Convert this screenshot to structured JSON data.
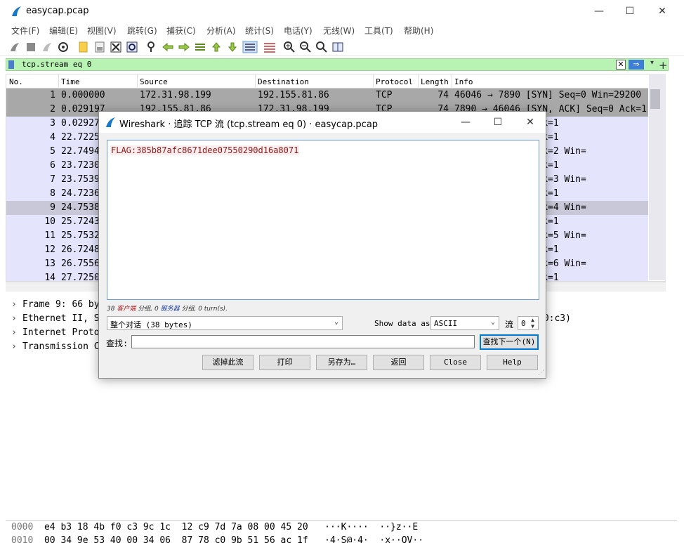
{
  "main_window": {
    "title": "easycap.pcap",
    "controls": {
      "minimize": "—",
      "maximize": "☐",
      "close": "✕"
    }
  },
  "menu": [
    "文件(F)",
    "编辑(E)",
    "视图(V)",
    "跳转(G)",
    "捕获(C)",
    "分析(A)",
    "统计(S)",
    "电话(Y)",
    "无线(W)",
    "工具(T)",
    "帮助(H)"
  ],
  "filter": {
    "value": "tcp.stream eq 0",
    "clear": "✕",
    "apply": "⇒",
    "dropdown": "▾",
    "add": "+"
  },
  "packet_list": {
    "columns": [
      "No.",
      "Time",
      "Source",
      "Destination",
      "Protocol",
      "Length",
      "Info"
    ],
    "rows": [
      {
        "no": "1",
        "time": "0.000000",
        "source": "172.31.98.199",
        "destination": "192.155.81.86",
        "protocol": "TCP",
        "length": "74",
        "info": "46046 → 7890 [SYN] Seq=0 Win=29200"
      },
      {
        "no": "2",
        "time": "0.029197",
        "source": "192.155.81.86",
        "destination": "172.31.98.199",
        "protocol": "TCP",
        "length": "74",
        "info": "7890 → 46046 [SYN, ACK] Seq=0 Ack=1"
      },
      {
        "no": "3",
        "time": "0.02927",
        "info": "H, ACK] Seq=1 Ack=1"
      },
      {
        "no": "4",
        "time": "22.7225",
        "info": "H, ACK] Seq=1 Ack=1"
      },
      {
        "no": "5",
        "time": "22.7494",
        "info": "H, ACK] Seq=1 Ack=2 Win="
      },
      {
        "no": "6",
        "time": "23.7230",
        "info": "H, ACK] Seq=2 Ack=1"
      },
      {
        "no": "7",
        "time": "23.7539",
        "info": "H, ACK] Seq=1 Ack=3 Win="
      },
      {
        "no": "8",
        "time": "24.7236",
        "info": "H, ACK] Seq=3 Ack=1"
      },
      {
        "no": "9",
        "time": "24.7538",
        "info": "H, ACK] Seq=1 Ack=4 Win="
      },
      {
        "no": "10",
        "time": "25.7243",
        "info": "H, ACK] Seq=4 Ack=1"
      },
      {
        "no": "11",
        "time": "25.7532",
        "info": "H, ACK] Seq=1 Ack=5 Win="
      },
      {
        "no": "12",
        "time": "26.7248",
        "info": "H, ACK] Seq=5 Ack=1"
      },
      {
        "no": "13",
        "time": "26.7556",
        "info": "H, ACK] Seq=1 Ack=6 Win="
      },
      {
        "no": "14",
        "time": "27.7250",
        "info": "H, ACK] Seq=6 Ack=1"
      }
    ]
  },
  "details": [
    {
      "label": "Frame 9: 66 by",
      "tail": ""
    },
    {
      "label": "Ethernet II, S",
      "tail": "f0:c3)"
    },
    {
      "label": "Internet Proto",
      "tail": ""
    },
    {
      "label": "Transmission C",
      "tail": ""
    }
  ],
  "bytes": [
    {
      "offset": "0000",
      "hex": "e4 b3 18 4b f0 c3 9c 1c  12 c9 7d 7a 08 00 45 20",
      "ascii": "···K····  ··}z··E"
    },
    {
      "offset": "0010",
      "hex": "00 34 9e 53 40 00 34 06  87 78 c0 9b 51 56 ac 1f",
      "ascii": "·4·S@·4·  ·x··QV··"
    }
  ],
  "dialog": {
    "title": "Wireshark · 追踪 TCP 流 (tcp.stream eq 0) · easycap.pcap",
    "stream_content": "FLAG:385b87afc8671dee07550290d16a8071",
    "stats": {
      "client_count": "38",
      "client_label": "客户端",
      "client_suffix": "分组,",
      "server_count": "0",
      "server_label": "服务器",
      "server_suffix": "分组, 0 turn(s)."
    },
    "conversation_select": "整个对话 (38 bytes)",
    "show_data_label": "Show data as",
    "show_data_value": "ASCII",
    "stream_label": "流",
    "stream_value": "0",
    "find_label": "查找:",
    "find_value": "",
    "find_next": "查找下一个(N)",
    "buttons": {
      "filter_out": "滤掉此流",
      "print": "打印",
      "save_as": "另存为…",
      "back": "返回",
      "close": "Close",
      "help": "Help"
    }
  },
  "colors": {
    "tcp_row": "#e4e4fc",
    "selected_row": "#c8c8d8",
    "handshake_row": "#a8a8a8",
    "filter_ok": "#b9f3b3",
    "flag_text": "#8b1a1a"
  }
}
